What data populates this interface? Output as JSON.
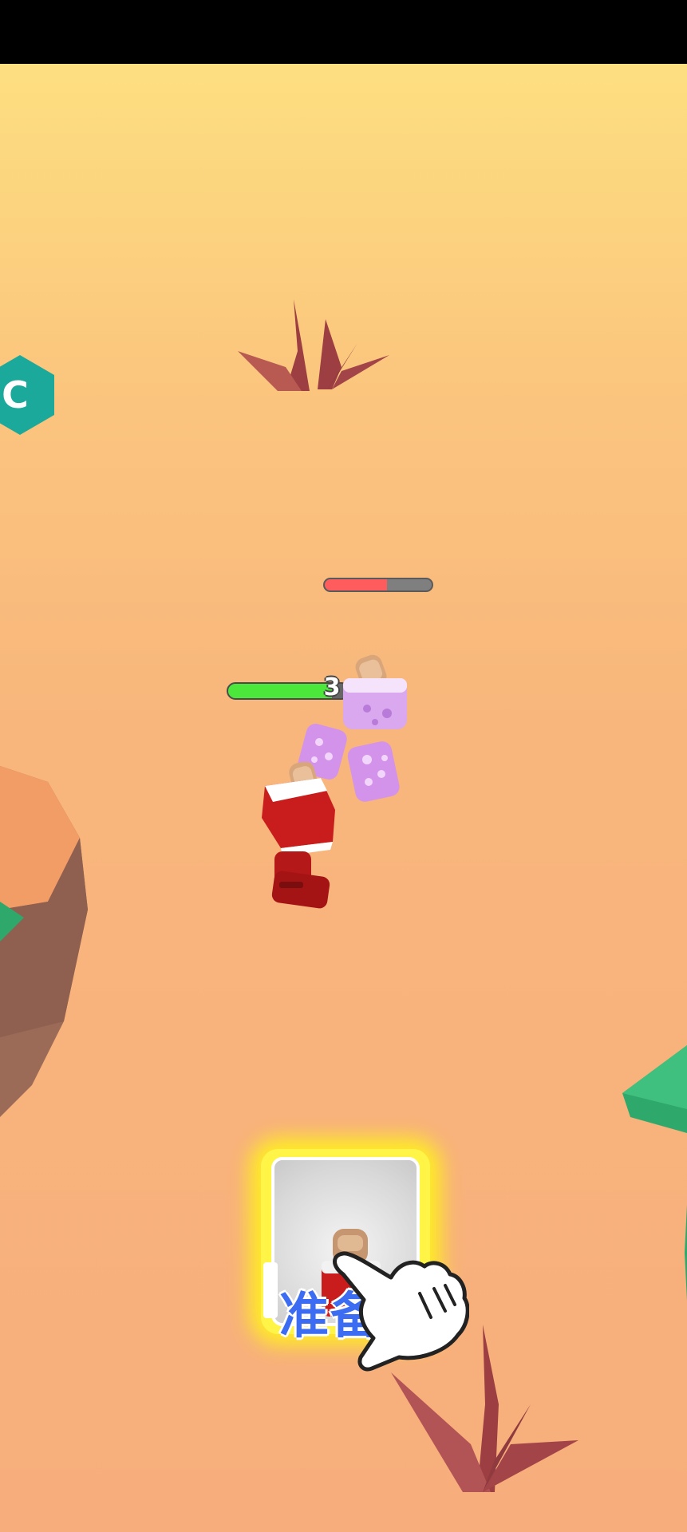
{
  "hud": {
    "level_badge_label": "C",
    "enemy_health_fraction": 0.58,
    "player_health_fraction": 0.86,
    "player_level": "3"
  },
  "card": {
    "ready_label": "准备"
  },
  "colors": {
    "sky_top": "#fddf80",
    "ground": "#f7ae7c",
    "badge": "#1aa99a",
    "enemy_health": "#ff5d5d",
    "player_health": "#4be83b",
    "card_glow": "#fff544",
    "card_label": "#3b6cf2"
  },
  "icons": [
    "tap-hand-icon",
    "hexagon-badge-icon"
  ]
}
